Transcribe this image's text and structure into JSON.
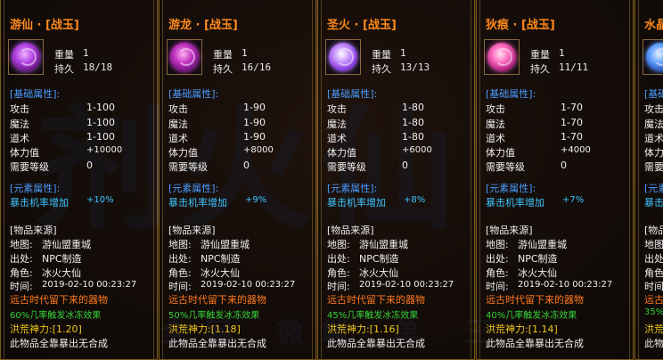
{
  "colors": {
    "title": "#ff8a1c",
    "section": "#4a9cff",
    "crit": "#3fc4ff",
    "effect": "#35d23a",
    "ancient": "#ff7a1e",
    "power": "#f0c81e",
    "text": "#f0f0f0"
  },
  "labels": {
    "weight": "重量",
    "durability": "持久",
    "base_header": "[基础属性]:",
    "attack": "攻击",
    "magic": "魔法",
    "taoism": "道术",
    "hp": "体力值",
    "level_req": "需要等级",
    "element_header": "[元素属性]:",
    "crit": "暴击机率增加",
    "source_header": "[物品来源]",
    "map": "地图:",
    "map_value": "游仙盟重城",
    "origin": "出处:",
    "origin_value": "NPC制造",
    "role": "角色:",
    "role_value": "冰火大仙",
    "time": "时间:",
    "time_value": "2019-02-10 00:23:27",
    "ancient": "远古时代留下来的器物",
    "drop": "此物品全靠暴出无合成"
  },
  "cards": [
    {
      "title": "游仙 · [战玉]",
      "weight": "1",
      "durability": "18/18",
      "attack": "1-100",
      "magic": "1-100",
      "taoism": "1-100",
      "hp": "+10000",
      "level": "0",
      "crit": "+10%",
      "effect": "60%几率触发冰冻效果",
      "power": "洪荒神力:[1.20]",
      "icon": "purple-swirl-orb-icon"
    },
    {
      "title": "游龙 · [战玉]",
      "weight": "1",
      "durability": "16/16",
      "attack": "1-90",
      "magic": "1-90",
      "taoism": "1-90",
      "hp": "+8000",
      "level": "0",
      "crit": "+9%",
      "effect": "50%几率触发冰冻效果",
      "power": "洪荒神力:[1.18]",
      "icon": "purple-dragon-orb-icon"
    },
    {
      "title": "圣火 · [战玉]",
      "weight": "1",
      "durability": "13/13",
      "attack": "1-80",
      "magic": "1-80",
      "taoism": "1-80",
      "hp": "+6000",
      "level": "0",
      "crit": "+8%",
      "effect": "45%几率触发冰冻效果",
      "power": "洪荒神力:[1.16]",
      "icon": "violet-flame-orb-icon"
    },
    {
      "title": "狄痕 · [战玉]",
      "weight": "1",
      "durability": "11/11",
      "attack": "1-70",
      "magic": "1-70",
      "taoism": "1-70",
      "hp": "+4000",
      "level": "0",
      "crit": "+7%",
      "effect": "40%几率触发冰冻效果",
      "power": "洪荒神力:[1.14]",
      "icon": "pink-swirl-orb-icon"
    },
    {
      "title": "水晶 · [战玉]",
      "effect": "35%",
      "icon": "blue-orb-icon"
    }
  ]
}
